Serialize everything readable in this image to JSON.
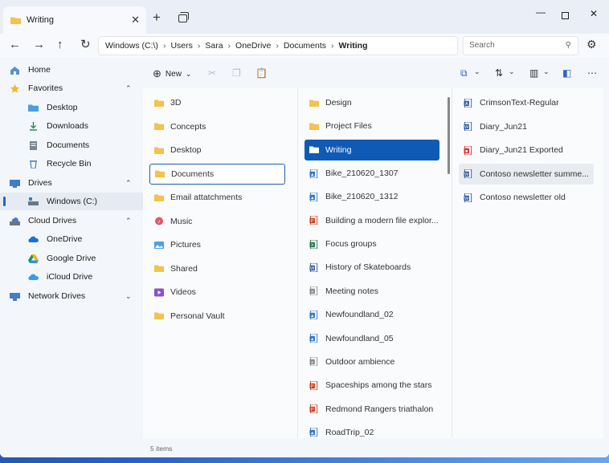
{
  "tab": {
    "title": "Writing",
    "close": "✕"
  },
  "window_controls": {
    "new_tab": "+",
    "minimize": "—",
    "close": "✕"
  },
  "nav": {
    "back": "←",
    "forward": "→",
    "up": "↑",
    "refresh": "↻"
  },
  "breadcrumb": [
    "Windows (C:\\)",
    "Users",
    "Sara",
    "OneDrive",
    "Documents",
    "Writing"
  ],
  "search": {
    "placeholder": "Search"
  },
  "sidebar": {
    "items": [
      {
        "label": "Home",
        "icon": "home-icon"
      },
      {
        "label": "Favorites",
        "icon": "star-icon",
        "expanded": true
      },
      {
        "label": "Desktop",
        "icon": "desktop-folder-icon"
      },
      {
        "label": "Downloads",
        "icon": "download-icon"
      },
      {
        "label": "Documents",
        "icon": "documents-icon"
      },
      {
        "label": "Recycle Bin",
        "icon": "recycle-bin-icon"
      },
      {
        "label": "Drives",
        "icon": "drive-icon",
        "expanded": true
      },
      {
        "label": "Windows (C:)",
        "icon": "windows-drive-icon",
        "selected": true
      },
      {
        "label": "Cloud Drives",
        "icon": "cloud-drives-icon",
        "expanded": true
      },
      {
        "label": "OneDrive",
        "icon": "onedrive-icon"
      },
      {
        "label": "Google Drive",
        "icon": "google-drive-icon"
      },
      {
        "label": "iCloud Drive",
        "icon": "icloud-icon"
      },
      {
        "label": "Network Drives",
        "icon": "network-drive-icon",
        "expanded": false
      }
    ]
  },
  "commandbar": {
    "new_label": "New"
  },
  "column1": [
    "3D",
    "Concepts",
    "Desktop",
    "Documents",
    "Email attatchments",
    "Music",
    "Pictures",
    "Shared",
    "Videos",
    "Personal Vault"
  ],
  "column2": [
    "Design",
    "Project Files",
    "Writing",
    "Bike_210620_1307",
    "Bike_210620_1312",
    "Building a modern file explor...",
    "Focus groups",
    "History of Skateboards",
    "Meeting notes",
    "Newfoundland_02",
    "Newfoundland_05",
    "Outdoor ambience",
    "Spaceships among the stars",
    "Redmond Rangers triathalon",
    "RoadTrip_02"
  ],
  "column3": [
    "CrimsonText-Regular",
    "Diary_Jun21",
    "Diary_Jun21 Exported",
    "Contoso newsletter summe...",
    "Contoso newsletter old"
  ],
  "status": {
    "items": "5 items"
  },
  "colors": {
    "accent": "#0f5ab5",
    "folder": "#f4c24d"
  }
}
